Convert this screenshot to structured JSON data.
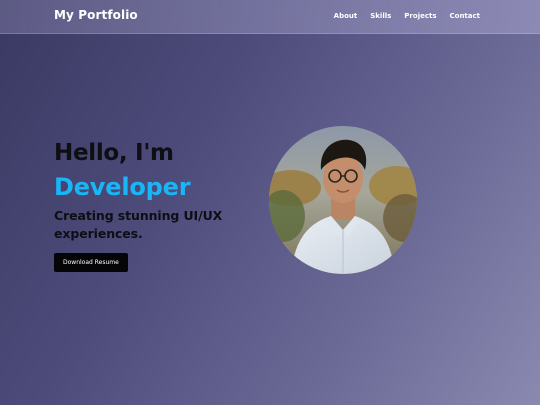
{
  "header": {
    "brand": "My Portfolio",
    "nav": [
      {
        "label": "About"
      },
      {
        "label": "Skills"
      },
      {
        "label": "Projects"
      },
      {
        "label": "Contact"
      }
    ]
  },
  "hero": {
    "greeting": "Hello, I'm",
    "role": "Developer",
    "tagline": "Creating stunning UI/UX experiences.",
    "resume_button": "Download Resume"
  },
  "colors": {
    "accent": "#19b6f7",
    "button_bg": "#050508",
    "text": "#0e0e14"
  },
  "icons": {
    "avatar": "profile-photo"
  }
}
